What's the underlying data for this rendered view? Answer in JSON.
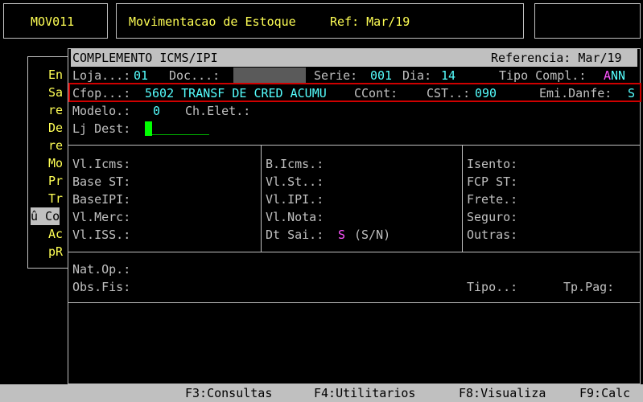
{
  "top": {
    "program_code": "MOV011",
    "title": "Movimentacao de Estoque",
    "ref": "Ref: Mar/19"
  },
  "menu_items": [
    "En",
    "Sa",
    "re",
    "De",
    "re",
    "Mo",
    "Pr",
    "Tr",
    "û Co",
    "Ac",
    "pR"
  ],
  "dialog": {
    "title": "COMPLEMENTO ICMS/IPI",
    "reference": "Referencia: Mar/19",
    "loja_label": "Loja...:",
    "loja_value": "01",
    "doc_label": "Doc...:",
    "serie_label": "Serie:",
    "serie_value": "001",
    "dia_label": "Dia:",
    "dia_value": "14",
    "tipo_compl_label": "Tipo Compl.:",
    "tipo_compl_value_a": "A",
    "tipo_compl_value_nn": "NN",
    "cfop_label": "Cfop...:",
    "cfop_value": "5602 TRANSF DE CRED ACUMU",
    "ccont_label": "CCont:",
    "cst_label": "CST..:",
    "cst_value": "090",
    "emi_danfe_label": "Emi.Danfe:",
    "emi_danfe_value": "S",
    "modelo_label": "Modelo.:",
    "modelo_value": "0",
    "ch_elet_label": "Ch.Elet.:",
    "lj_dest_label": "Lj Dest:"
  },
  "values_grid": {
    "col1": [
      "Vl.Icms:",
      "Base ST:",
      "BaseIPI:",
      "Vl.Merc:",
      "Vl.ISS.:"
    ],
    "col2": [
      "B.Icms.:",
      "Vl.St..:",
      "Vl.IPI.:",
      "Vl.Nota:",
      "Dt Sai.:"
    ],
    "dt_sai_value": "S",
    "dt_sai_hint": "(S/N)",
    "col3": [
      "Isento:",
      "FCP ST:",
      "Frete.:",
      "Seguro:",
      "Outras:"
    ]
  },
  "bottom_fields": {
    "nat_op_label": "Nat.Op.:",
    "obs_fis_label": "Obs.Fis:",
    "tipo_label": "Tipo..:",
    "tp_pag_label": "Tp.Pag:"
  },
  "function_keys": {
    "f3": "F3:Consultas",
    "f4": "F4:Utilitarios",
    "f8": "F8:Visualiza",
    "f9": "F9:Calc"
  },
  "colors": {
    "background": "#000000",
    "label": "#c0c0c0",
    "value": "#55ffff",
    "title": "#ffff55",
    "accent": "#ff55ff",
    "cursor": "#00ff00",
    "highlight": "#d00000"
  }
}
